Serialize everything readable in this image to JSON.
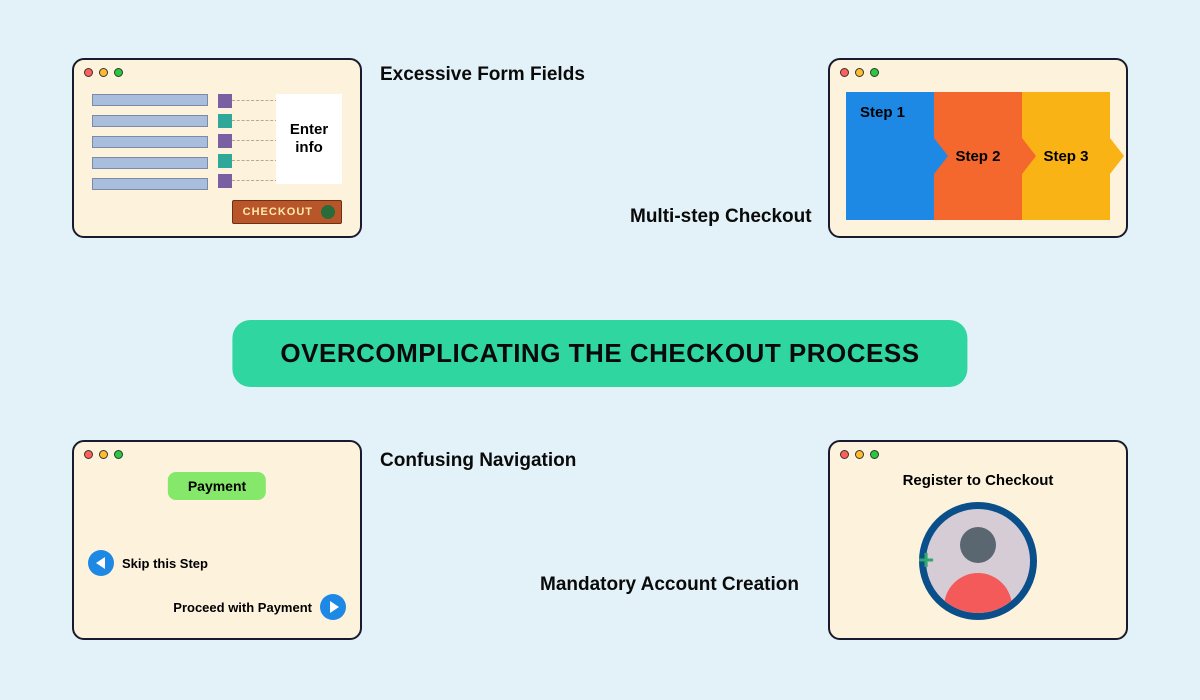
{
  "title": "OVERCOMPLICATING THE CHECKOUT PROCESS",
  "cards": {
    "excessive_form_fields": {
      "label": "Excessive Form Fields",
      "enter_info": "Enter info",
      "checkout_btn": "CHECKOUT"
    },
    "multi_step_checkout": {
      "label": "Multi-step Checkout",
      "steps": [
        "Step 1",
        "Step 2",
        "Step 3"
      ]
    },
    "confusing_navigation": {
      "label": "Confusing Navigation",
      "payment": "Payment",
      "skip": "Skip this Step",
      "proceed": "Proceed with Payment"
    },
    "mandatory_account": {
      "label": "Mandatory Account Creation",
      "register": "Register to Checkout"
    }
  },
  "colors": {
    "bg": "#e3f2f9",
    "window_bg": "#fdf2dc",
    "title_bg": "#2fd6a0",
    "blue": "#1e88e5",
    "orange": "#f4682e",
    "yellow": "#f9b315",
    "green_pill": "#86e86b"
  }
}
